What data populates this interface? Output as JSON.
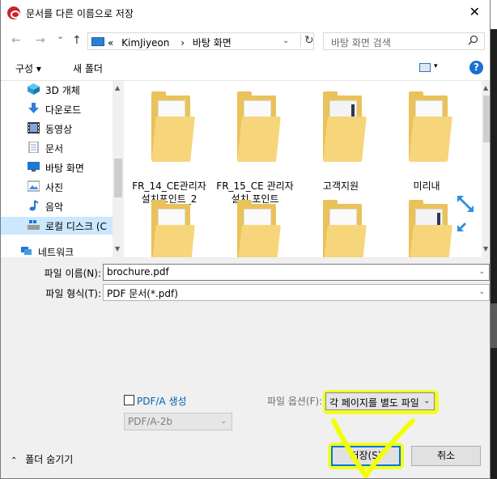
{
  "window": {
    "title": "문서를 다른 이름으로 저장",
    "close": "✕"
  },
  "nav": {
    "back": "←",
    "forward": "→",
    "recent": "⌄",
    "up": "↑",
    "breadcrumb": [
      "«",
      "KimJiyeon",
      "›",
      "바탕 화면"
    ],
    "address_dropdown": "⌄",
    "refresh": "↻",
    "search_placeholder": "바탕 화면 검색"
  },
  "toolbar": {
    "organize": "구성 ▾",
    "new_folder": "새 폴더",
    "view_dropdown": "▾",
    "help": "?"
  },
  "sidebar": {
    "items": [
      {
        "label": "3D 개체",
        "icon": "3d-objects-icon"
      },
      {
        "label": "다운로드",
        "icon": "download-icon"
      },
      {
        "label": "동영상",
        "icon": "video-icon"
      },
      {
        "label": "문서",
        "icon": "document-icon"
      },
      {
        "label": "바탕 화면",
        "icon": "desktop-icon"
      },
      {
        "label": "사진",
        "icon": "pictures-icon"
      },
      {
        "label": "음악",
        "icon": "music-icon"
      },
      {
        "label": "로컬 디스크 (C",
        "icon": "local-disk-icon",
        "selected": true
      },
      {
        "label": "네트워크",
        "icon": "network-icon"
      }
    ],
    "scroll_up": "▲",
    "scroll_down": "▼"
  },
  "files": {
    "items": [
      {
        "name": "FR_14_CE관리자 설치포인트_2",
        "icon": "folder-icon"
      },
      {
        "name": "FR_15_CE 관리자 설치 포인트",
        "icon": "folder-icon"
      },
      {
        "name": "고객지원",
        "icon": "folder-icon"
      },
      {
        "name": "미리내",
        "icon": "folder-icon"
      },
      {
        "name": "",
        "icon": "folder-icon"
      },
      {
        "name": "",
        "icon": "folder-icon"
      },
      {
        "name": "",
        "icon": "folder-icon"
      },
      {
        "name": "",
        "icon": "folder-icon"
      }
    ],
    "scroll_up": "▲",
    "scroll_down": "▼"
  },
  "form": {
    "filename_label": "파일 이름(N):",
    "filename_value": "brochure.pdf",
    "filetype_label": "파일 형식(T):",
    "filetype_value": "PDF 문서(*.pdf)",
    "dropdown": "⌄"
  },
  "options": {
    "pdfa_label": "PDF/A 생성",
    "pdfa_checked": false,
    "pdfa_version": "PDF/A-2b",
    "file_option_label": "파일 옵션(F):",
    "file_option_value": "각 페이지를 별도 파일"
  },
  "footer": {
    "hide_folders": "폴더 숨기기",
    "chevron": "⌃",
    "save": "저장(S)",
    "cancel": "취소"
  },
  "colors": {
    "highlight": "#f2ff00",
    "accent": "#0078d7",
    "folder": "#e9c25a"
  }
}
